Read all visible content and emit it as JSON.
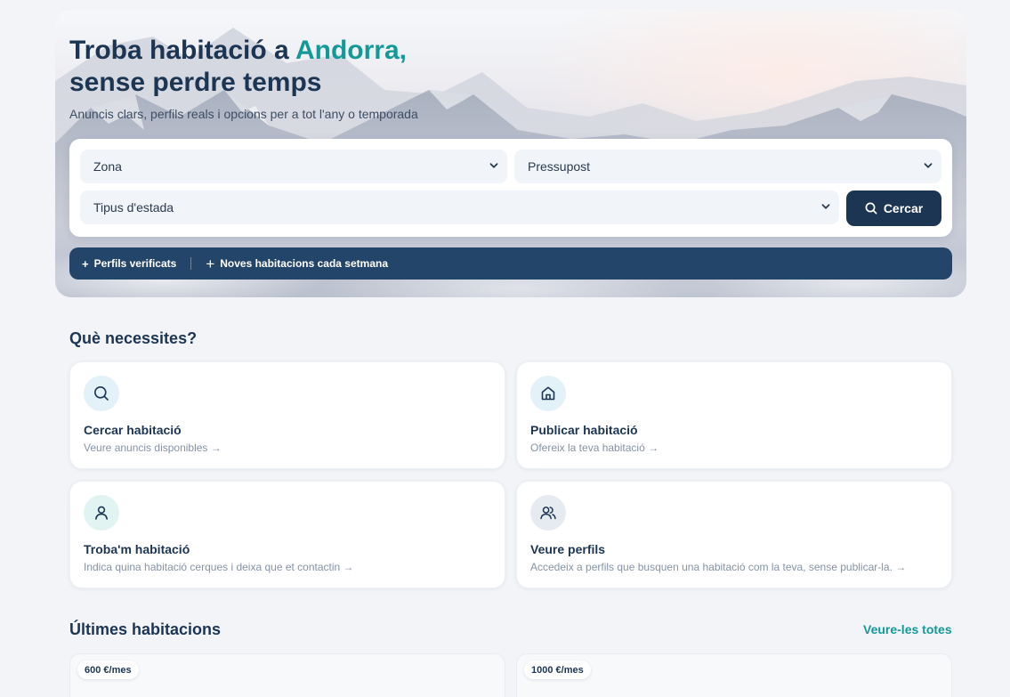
{
  "hero": {
    "title_line1_prefix": "Troba habitació a ",
    "title_line1_accent": "Andorra,",
    "title_line2": "sense perdre temps",
    "subtitle": "Anuncis clars, perfils reals i opcions per a tot l'any o temporada"
  },
  "search": {
    "zona_value": "Zona",
    "pressupost_value": "Pressupost",
    "tipus_value": "Tipus d'estada",
    "search_button": "Cercar"
  },
  "info_bar": {
    "item1": "Perfils verificats",
    "item2": "Noves habitacions cada setmana"
  },
  "needs": {
    "title": "Què necessites?",
    "cards": [
      {
        "title": "Cercar habitació",
        "subtitle": "Veure anuncis disponibles →",
        "icon": "search-icon"
      },
      {
        "title": "Publicar habitació",
        "subtitle": "Ofereix la teva habitació →",
        "icon": "home-icon"
      },
      {
        "title": "Troba'm habitació",
        "subtitle": "Indica quina habitació cerques i deixa que et contactin →",
        "icon": "user-icon"
      },
      {
        "title": "Veure perfils",
        "subtitle": "Accedeix a perfils que busquen una habitació com la teva, sense publicar-la. →",
        "icon": "users-icon"
      }
    ]
  },
  "latest": {
    "title": "Últimes habitacions",
    "see_all": "Veure-les totes",
    "listings": [
      {
        "price": "600 €/mes"
      },
      {
        "price": "1000 €/mes"
      }
    ]
  },
  "colors": {
    "navy": "#1c3553",
    "accent_teal": "#139a98",
    "info_bar": "#24456a",
    "background": "#f2f4f7"
  }
}
